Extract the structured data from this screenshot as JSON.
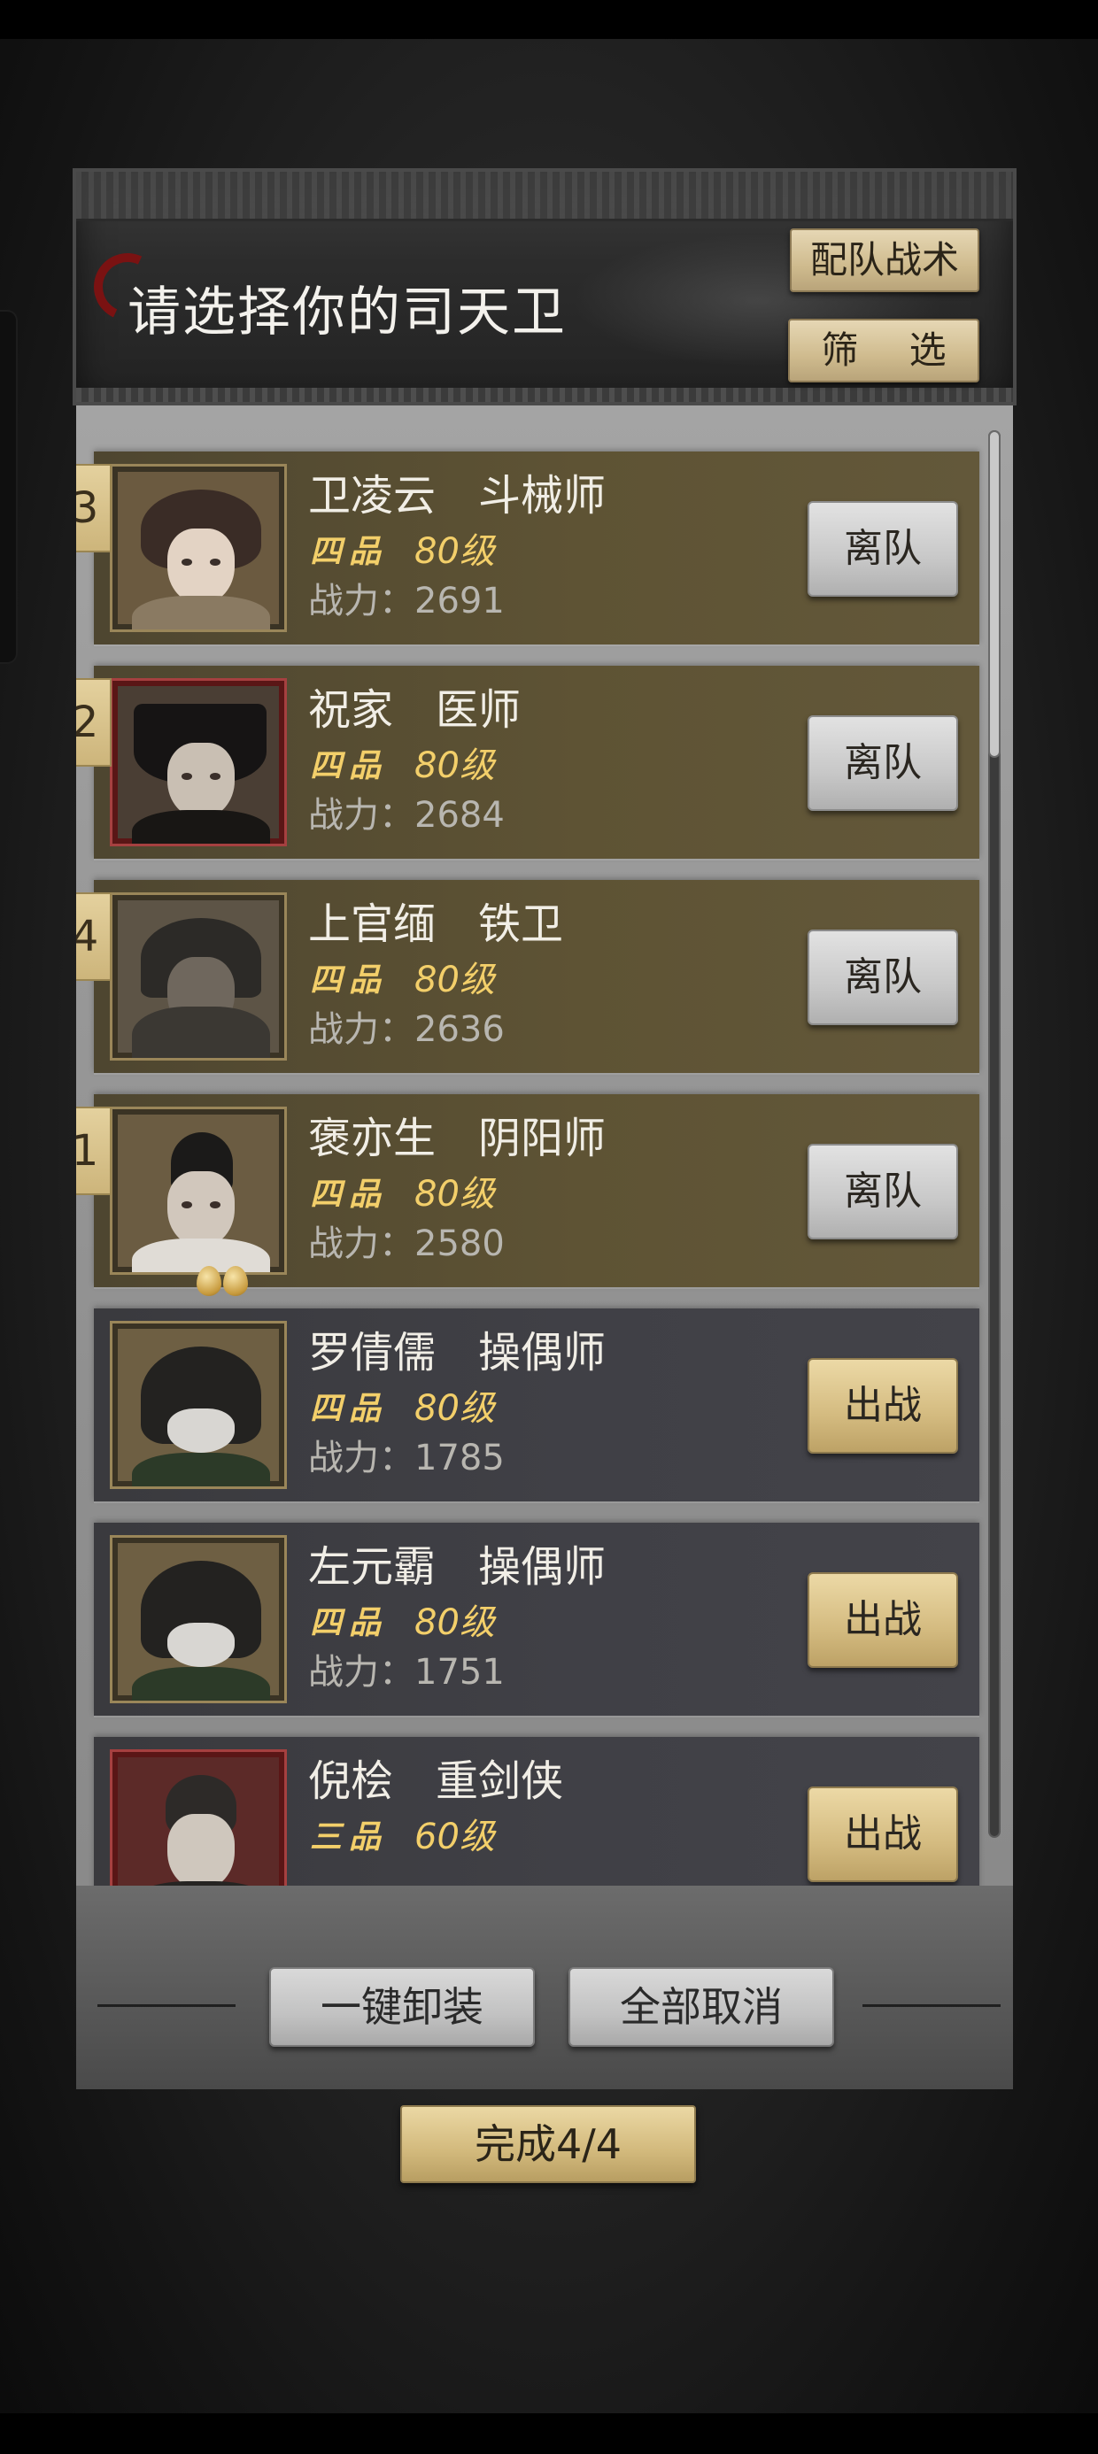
{
  "header": {
    "title": "请选择你的司天卫",
    "tactics_label": "配队战术",
    "filter_label": "筛 选"
  },
  "colors": {
    "gold_text": "#f3cf6a",
    "active_card": "#5e5334",
    "idle_card": "#404046"
  },
  "characters": [
    {
      "rank": "3",
      "name": "卫凌云　斗械师",
      "grade": "四品",
      "level": "80级",
      "power": "战力：2691",
      "action": "离队",
      "portrait_icon": "portrait-girl-icon"
    },
    {
      "rank": "2",
      "name": "祝家　医师",
      "grade": "四品",
      "level": "80级",
      "power": "战力：2684",
      "action": "离队",
      "portrait_icon": "portrait-hatted-man-icon"
    },
    {
      "rank": "4",
      "name": "上官缅　铁卫",
      "grade": "四品",
      "level": "80级",
      "power": "战力：2636",
      "action": "离队",
      "portrait_icon": "portrait-armored-icon"
    },
    {
      "rank": "1",
      "name": "褒亦生　阴阳师",
      "grade": "四品",
      "level": "80级",
      "power": "战力：2580",
      "action": "离队",
      "portrait_icon": "portrait-scholar-icon"
    },
    {
      "name": "罗倩儒　操偶师",
      "grade": "四品",
      "level": "80级",
      "power": "战力：1785",
      "action": "出战",
      "portrait_icon": "portrait-hooded-icon"
    },
    {
      "name": "左元霸　操偶师",
      "grade": "四品",
      "level": "80级",
      "power": "战力：1751",
      "action": "出战",
      "portrait_icon": "portrait-hooded-icon"
    },
    {
      "name": "倪桧　重剑侠",
      "grade": "三品",
      "level": "60级",
      "action": "出战",
      "portrait_icon": "portrait-swordsman-icon"
    }
  ],
  "footer": {
    "unequip_all_label": "一键卸装",
    "cancel_all_label": "全部取消"
  },
  "done_label": "完成4/4"
}
